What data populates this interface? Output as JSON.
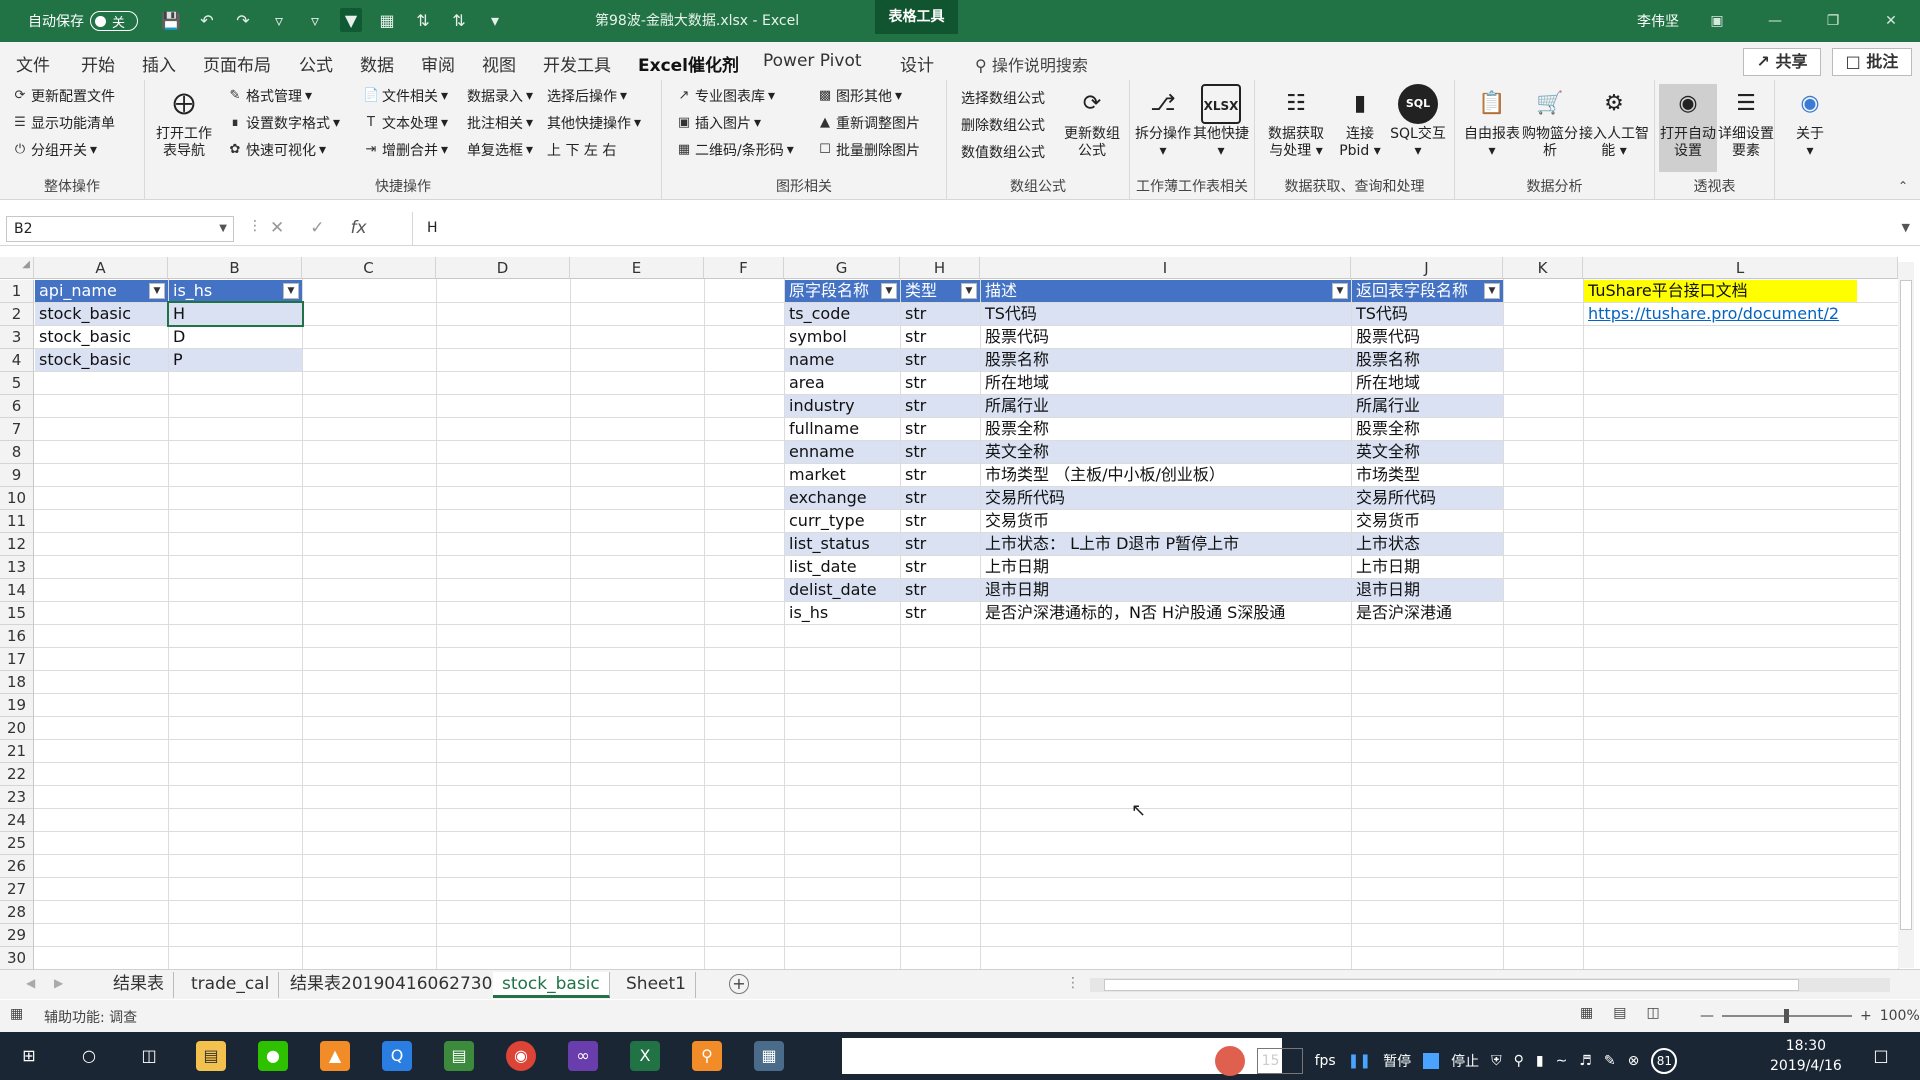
{
  "titlebar": {
    "autosave_label": "自动保存",
    "autosave_state": "关",
    "doc_title": "第98波-金融大数据.xlsx  -  Excel",
    "context_tab": "表格工具",
    "user": "李伟坚"
  },
  "tabs": [
    "文件",
    "开始",
    "插入",
    "页面布局",
    "公式",
    "数据",
    "审阅",
    "视图",
    "开发工具",
    "Excel催化剂",
    "Power Pivot",
    "设计"
  ],
  "active_tab": "Excel催化剂",
  "search_placeholder": "操作说明搜索",
  "share_label": "共享",
  "comment_label": "批注",
  "ribbon": {
    "group1": {
      "label": "整体操作",
      "items": [
        "更新配置文件",
        "显示功能清单",
        "分组开关"
      ]
    },
    "group2": {
      "label": "快捷操作",
      "big": "打开工作表导航",
      "col1": [
        "格式管理",
        "设置数字格式",
        "快速可视化"
      ],
      "col2": [
        "文件相关",
        "文本处理",
        "增删合并"
      ],
      "col3": [
        "数据录入",
        "批注相关",
        "单复选框"
      ],
      "col4": [
        "选择后操作",
        "其他快捷操作",
        "上  下  左  右"
      ]
    },
    "group3": {
      "label": "图形相关",
      "col1": [
        "专业图表库",
        "插入图片",
        "二维码/条形码"
      ],
      "col2": [
        "图形其他",
        "重新调整图片",
        "批量删除图片"
      ]
    },
    "group4": {
      "label": "数组公式",
      "items": [
        "选择数组公式",
        "删除数组公式",
        "数值数组公式"
      ],
      "big": "更新数组公式"
    },
    "group5": {
      "label": "工作薄工作表相关",
      "big1": "拆分操作",
      "big2": "其他快捷"
    },
    "group6": {
      "label": "数据获取、查询和处理",
      "big1": "数据获取与处理",
      "big2": "连接Pbid",
      "big3": "SQL交互"
    },
    "group7": {
      "label": "数据分析",
      "big1": "自由报表",
      "big2": "购物篮分析",
      "big3": "接入人工智能"
    },
    "group8": {
      "label": "透视表",
      "big1": "打开自动设置",
      "big2": "详细设置要素"
    },
    "group9": {
      "big": "关于"
    }
  },
  "formula_bar": {
    "name_box": "B2",
    "formula": "H",
    "fx": "fx"
  },
  "columns": [
    {
      "label": "A"
    },
    {
      "label": "B"
    },
    {
      "label": "C"
    },
    {
      "label": "D"
    },
    {
      "label": "E"
    },
    {
      "label": "F"
    },
    {
      "label": "G"
    },
    {
      "label": "H"
    },
    {
      "label": "I"
    },
    {
      "label": "J"
    },
    {
      "label": "K"
    },
    {
      "label": "L"
    }
  ],
  "rows": [
    "1",
    "2",
    "3",
    "4",
    "5",
    "6",
    "7",
    "8",
    "9",
    "10",
    "11",
    "12",
    "13",
    "14",
    "15",
    "16",
    "17",
    "18",
    "19",
    "20",
    "21",
    "22",
    "23",
    "24",
    "25",
    "26",
    "27",
    "28",
    "29",
    "30"
  ],
  "table1": {
    "headers": [
      "api_name",
      "is_hs"
    ],
    "rows": [
      [
        "stock_basic",
        "H"
      ],
      [
        "stock_basic",
        "D"
      ],
      [
        "stock_basic",
        "P"
      ]
    ]
  },
  "table2": {
    "headers": [
      "原字段名称",
      "类型",
      "描述",
      "返回表字段名称"
    ],
    "rows": [
      [
        "ts_code",
        "str",
        "TS代码",
        "TS代码"
      ],
      [
        "symbol",
        "str",
        "股票代码",
        "股票代码"
      ],
      [
        "name",
        "str",
        "股票名称",
        "股票名称"
      ],
      [
        "area",
        "str",
        "所在地域",
        "所在地域"
      ],
      [
        "industry",
        "str",
        "所属行业",
        "所属行业"
      ],
      [
        "fullname",
        "str",
        "股票全称",
        "股票全称"
      ],
      [
        "enname",
        "str",
        "英文全称",
        "英文全称"
      ],
      [
        "market",
        "str",
        "市场类型 （主板/中小板/创业板）",
        "市场类型"
      ],
      [
        "exchange",
        "str",
        "交易所代码",
        "交易所代码"
      ],
      [
        "curr_type",
        "str",
        "交易货币",
        "交易货币"
      ],
      [
        "list_status",
        "str",
        "上市状态： L上市 D退市 P暂停上市",
        "上市状态"
      ],
      [
        "list_date",
        "str",
        "上市日期",
        "上市日期"
      ],
      [
        "delist_date",
        "str",
        "退市日期",
        "退市日期"
      ],
      [
        "is_hs",
        "str",
        "是否沪深港通标的，N否 H沪股通 S深股通",
        "是否沪深港通"
      ]
    ]
  },
  "doc_link": {
    "label": "TuShare平台接口文档",
    "url": "https://tushare.pro/document/2"
  },
  "sheets": [
    "结果表",
    "trade_cal",
    "结果表20190416062730",
    "stock_basic",
    "Sheet1"
  ],
  "active_sheet": "stock_basic",
  "status": {
    "accessibility": "辅助功能: 调查",
    "zoom": "100%"
  },
  "taskbar": {
    "fps_value": "15",
    "fps_label": "fps",
    "pause": "暂停",
    "stop": "停止",
    "badge": "81",
    "time": "18:30",
    "date": "2019/4/16"
  }
}
